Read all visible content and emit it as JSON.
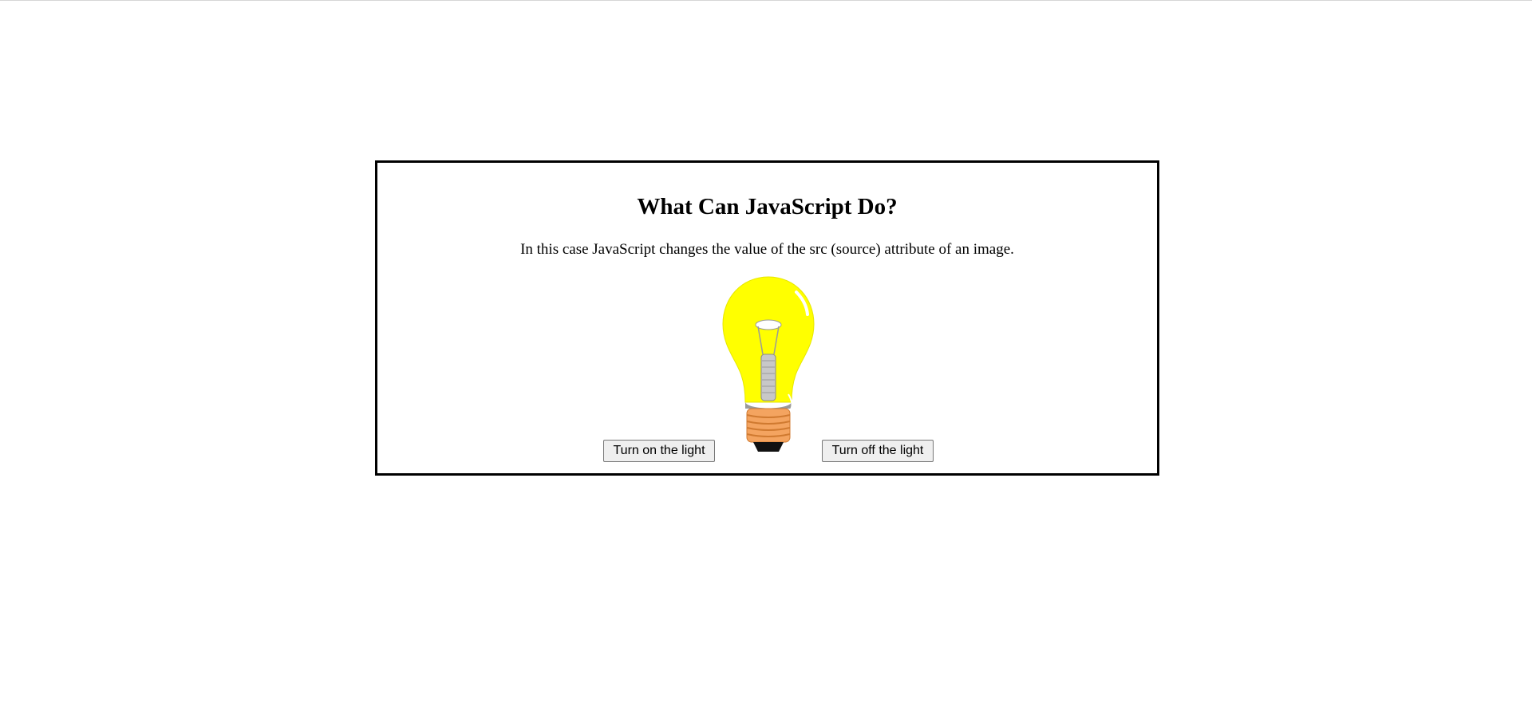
{
  "page": {
    "title": "What Can JavaScript Do?",
    "description": "In this case JavaScript changes the value of the src (source) attribute of an image."
  },
  "bulb": {
    "state": "on",
    "icon": "lightbulb-on-icon",
    "colors": {
      "glass": "#ffff00",
      "base": "#f4a460",
      "tip": "#111111",
      "filament": "#b0b0b0"
    }
  },
  "buttons": {
    "on_label": "Turn on the light",
    "off_label": "Turn off the light"
  }
}
